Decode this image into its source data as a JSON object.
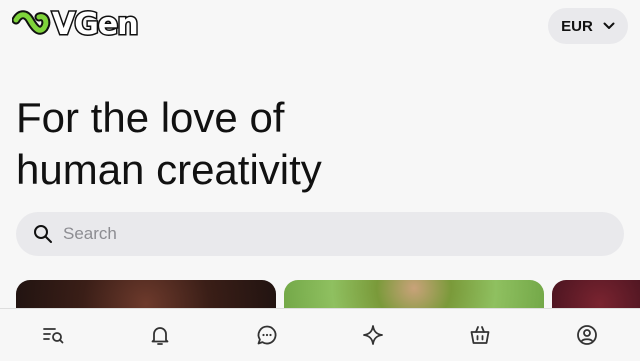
{
  "header": {
    "brand_name": "VGen",
    "logo_mark_color": "#7fd43b",
    "currency": {
      "label": "EUR",
      "icon": "chevron-down-icon"
    }
  },
  "hero": {
    "line1": "For the love of",
    "line2": "human creativity"
  },
  "search": {
    "placeholder": "Search",
    "value": "",
    "icon": "search-icon"
  },
  "bottom_nav": {
    "items": [
      {
        "name": "discover",
        "icon": "list-search-icon"
      },
      {
        "name": "notifications",
        "icon": "bell-icon"
      },
      {
        "name": "messages",
        "icon": "chat-bubble-icon"
      },
      {
        "name": "sparkle",
        "icon": "sparkle-icon"
      },
      {
        "name": "shop",
        "icon": "shopping-bag-icon"
      },
      {
        "name": "profile",
        "icon": "user-circle-icon"
      }
    ]
  }
}
